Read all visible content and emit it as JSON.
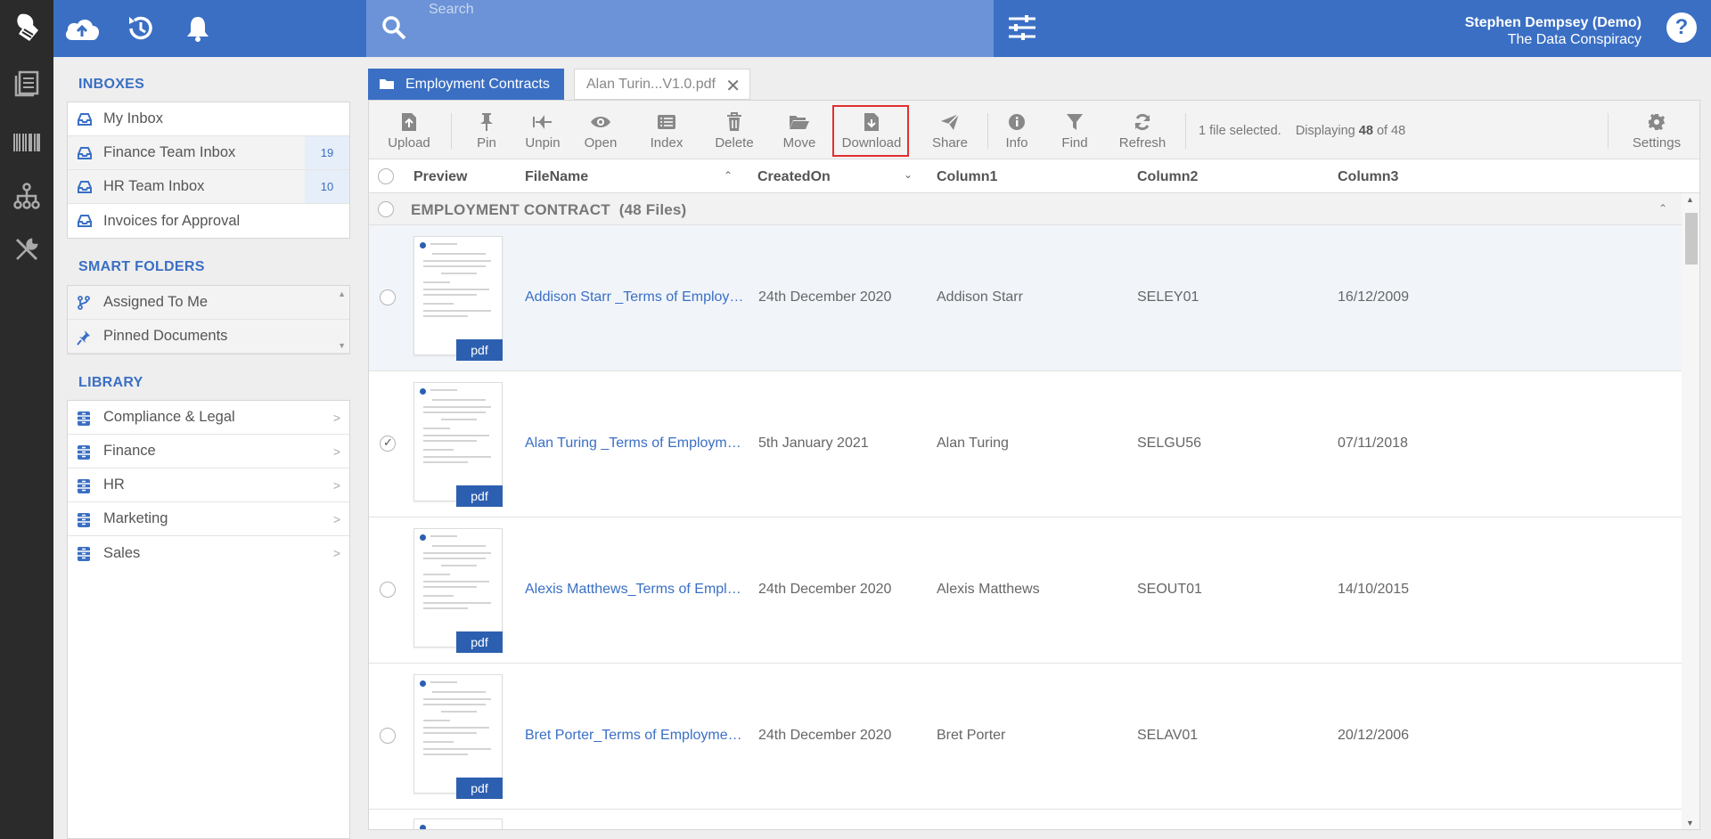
{
  "header": {
    "search_placeholder": "Search",
    "user_name": "Stephen Dempsey (Demo)",
    "user_org": "The Data Conspiracy",
    "help_label": "?"
  },
  "sidebar": {
    "inboxes_title": "INBOXES",
    "inboxes": [
      {
        "label": "My Inbox",
        "count": ""
      },
      {
        "label": "Finance Team Inbox",
        "count": "19"
      },
      {
        "label": "HR Team Inbox",
        "count": "10"
      },
      {
        "label": "Invoices for Approval",
        "count": ""
      }
    ],
    "smart_folders_title": "SMART FOLDERS",
    "smart_folders": [
      {
        "label": "Assigned To Me"
      },
      {
        "label": "Pinned Documents"
      }
    ],
    "library_title": "LIBRARY",
    "library": [
      {
        "label": "Compliance & Legal"
      },
      {
        "label": "Finance"
      },
      {
        "label": "HR"
      },
      {
        "label": "Marketing"
      },
      {
        "label": "Sales"
      }
    ]
  },
  "tabs": {
    "active": "Employment Contracts",
    "secondary": "Alan Turin...V1.0.pdf"
  },
  "toolbar": {
    "upload": "Upload",
    "pin": "Pin",
    "unpin": "Unpin",
    "open": "Open",
    "index": "Index",
    "delete": "Delete",
    "move": "Move",
    "download": "Download",
    "share": "Share",
    "info": "Info",
    "find": "Find",
    "refresh": "Refresh",
    "settings": "Settings",
    "status_selected": "1 file selected.",
    "status_displaying": "Displaying",
    "status_shown": "48",
    "status_of": "of 48"
  },
  "table": {
    "headers": {
      "preview": "Preview",
      "filename": "FileName",
      "createdon": "CreatedOn",
      "col1": "Column1",
      "col2": "Column2",
      "col3": "Column3"
    },
    "group_label": "EMPLOYMENT CONTRACT",
    "group_count": "(48 Files)",
    "badge": "pdf",
    "rows": [
      {
        "filename": "Addison Starr _Terms of Employment.pdf",
        "created": "24th December 2020",
        "col1": "Addison Starr",
        "col2": "SELEY01",
        "col3": "16/12/2009",
        "selected": false
      },
      {
        "filename": "Alan Turing _Terms of Employment.pdf",
        "created": "5th January 2021",
        "col1": "Alan Turing",
        "col2": "SELGU56",
        "col3": "07/11/2018",
        "selected": true
      },
      {
        "filename": "Alexis Matthews_Terms of Employment.pdf",
        "created": "24th December 2020",
        "col1": "Alexis Matthews",
        "col2": "SEOUT01",
        "col3": "14/10/2015",
        "selected": false
      },
      {
        "filename": "Bret Porter_Terms of Employment.pdf",
        "created": "24th December 2020",
        "col1": "Bret Porter",
        "col2": "SELAV01",
        "col3": "20/12/2006",
        "selected": false
      }
    ]
  },
  "colors": {
    "brand_blue": "#3a6fc4",
    "rail_dark": "#2b2b2b",
    "highlight_red": "#e03030"
  }
}
